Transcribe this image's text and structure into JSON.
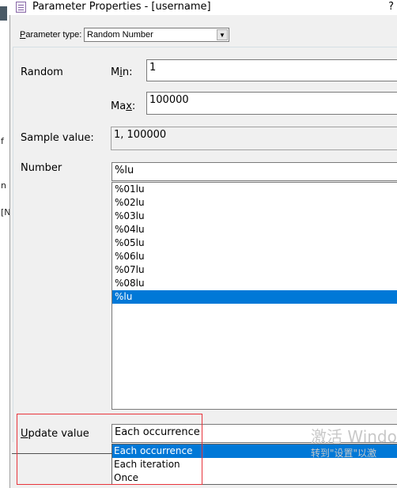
{
  "window": {
    "title": "Parameter Properties - [username]",
    "help": "?"
  },
  "background_glyphs": [
    "f",
    "n",
    "[N"
  ],
  "parameter_type": {
    "label_pre": "P",
    "label_post": "arameter type:",
    "selected": "Random Number"
  },
  "random": {
    "label": "Random",
    "min_label_pre": "M",
    "min_label_ul": "i",
    "min_label_post": "n:",
    "min_value": "1",
    "max_label_pre": "Ma",
    "max_label_ul": "x",
    "max_label_post": ":",
    "max_value": "100000"
  },
  "sample": {
    "label": "Sample value:",
    "value": "1, 100000"
  },
  "number": {
    "label": "Number",
    "value": "%lu",
    "formats": [
      "%01lu",
      "%02lu",
      "%03lu",
      "%04lu",
      "%05lu",
      "%06lu",
      "%07lu",
      "%08lu",
      "%lu"
    ],
    "selected_index": 8
  },
  "update": {
    "label_ul": "U",
    "label_post": "pdate value",
    "value": "Each occurrence",
    "options": [
      "Each occurrence",
      "Each iteration",
      "Once"
    ],
    "selected_index": 0
  },
  "watermark": {
    "line1": "激活 Windo",
    "line2": "转到\"设置\"以激"
  },
  "colors": {
    "selection": "#0078d7",
    "highlight_box": "#e8343c"
  }
}
